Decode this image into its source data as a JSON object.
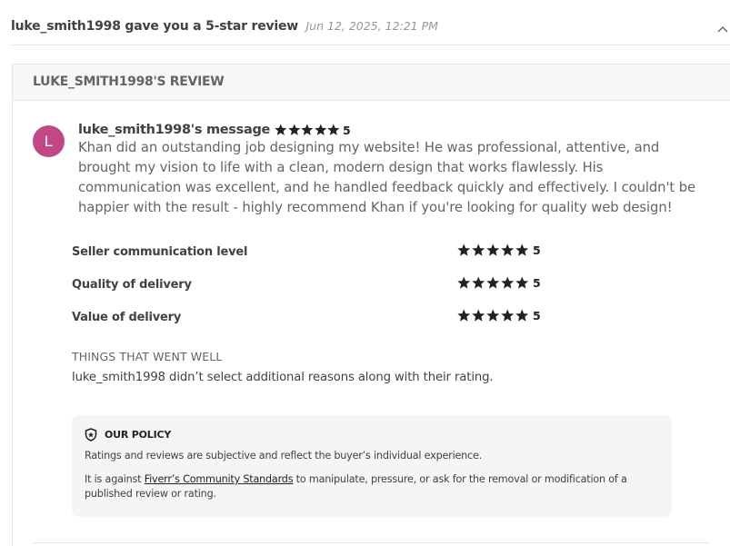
{
  "event": {
    "title": "luke_smith1998 gave you a 5-star review",
    "date": "Jun 12, 2025, 12:21 PM"
  },
  "review": {
    "header_title": "LUKE_SMITH1998'S REVIEW",
    "avatar_letter": "L",
    "avatar_color": "#c14884",
    "message_author": "luke_smith1998's message",
    "overall_rating": "5",
    "message": "Khan did an outstanding job designing my website! He was professional, attentive, and brought my vision to life with a clean, modern design that works flawlessly. His communication was excellent, and he handled feedback quickly and effectively. I couldn't be happier with the result - highly recommend Khan if you're looking for quality web design!",
    "criteria": [
      {
        "label": "Seller communication level",
        "rating": "5"
      },
      {
        "label": "Quality of delivery",
        "rating": "5"
      },
      {
        "label": "Value of delivery",
        "rating": "5"
      }
    ],
    "went_well_title": "THINGS THAT WENT WELL",
    "went_well_text": "luke_smith1998 didn’t select additional reasons along with their rating."
  },
  "policy": {
    "title": "OUR POLICY",
    "p1": "Ratings and reviews are subjective and reflect the buyer’s individual experience.",
    "p2_before": "It is against ",
    "p2_link": "Fiverr’s Community Standards",
    "p2_after": " to manipulate, pressure, or ask for the removal or modification of a published review or rating."
  },
  "icons": {
    "collapse": "chevron-up-icon",
    "star": "star-icon",
    "policy": "shield-icon"
  },
  "colors": {
    "star": "#222325",
    "avatar": "#c14884",
    "policy_bg": "#f5f5f5"
  }
}
